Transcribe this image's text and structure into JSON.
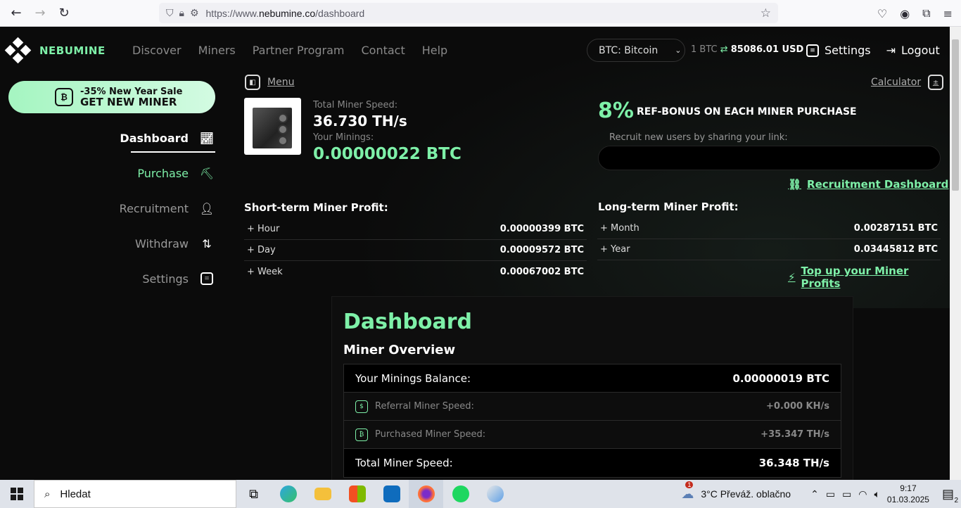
{
  "browser": {
    "url_prefix": "https://www.",
    "url_host": "nebumine.co",
    "url_path": "/dashboard"
  },
  "header": {
    "logo": "NEBUMINE",
    "nav": [
      "Discover",
      "Miners",
      "Partner Program",
      "Contact",
      "Help"
    ],
    "coin_select": "BTC: Bitcoin",
    "rate_prefix": "1 BTC",
    "rate_value": "85086.01 USD",
    "settings": "Settings",
    "logout": "Logout"
  },
  "sale": {
    "line1": "-35% New Year Sale",
    "line2": "GET NEW MINER"
  },
  "sidebar": {
    "items": [
      {
        "label": "Dashboard",
        "icon": "chart-icon"
      },
      {
        "label": "Purchase",
        "icon": "pickaxe-icon"
      },
      {
        "label": "Recruitment",
        "icon": "add-user-icon"
      },
      {
        "label": "Withdraw",
        "icon": "exchange-icon"
      },
      {
        "label": "Settings",
        "icon": "settings-icon"
      }
    ]
  },
  "main": {
    "menu": "Menu",
    "calculator": "Calculator",
    "total_speed_label": "Total Miner Speed:",
    "total_speed": "36.730 TH/s",
    "minings_label": "Your Minings:",
    "minings": "0.00000022 BTC",
    "ref_pct": "8%",
    "ref_text": "REF-BONUS ON EACH MINER PURCHASE",
    "ref_label": "Recruit new users by sharing your link:",
    "recruit_link": "Recruitment Dashboard",
    "short_title": "Short-term Miner Profit:",
    "short_rows": [
      {
        "label": "+ Hour",
        "value": "0.00000399 BTC"
      },
      {
        "label": "+ Day",
        "value": "0.00009572 BTC"
      },
      {
        "label": "+ Week",
        "value": "0.00067002 BTC"
      }
    ],
    "long_title": "Long-term Miner Profit:",
    "long_rows": [
      {
        "label": "+ Month",
        "value": "0.00287151 BTC"
      },
      {
        "label": "+ Year",
        "value": "0.03445812 BTC"
      }
    ],
    "topup": "Top up your Miner Profits"
  },
  "dashboard": {
    "title": "Dashboard",
    "overview": "Miner Overview",
    "rows": [
      {
        "label": "Your Minings Balance:",
        "value": "0.00000019 BTC"
      },
      {
        "label": "Referral Miner Speed:",
        "value": "+0.000 KH/s"
      },
      {
        "label": "Purchased Miner Speed:",
        "value": "+35.347 TH/s"
      },
      {
        "label": "Total Miner Speed:",
        "value": "36.348 TH/s"
      }
    ]
  },
  "taskbar": {
    "search": "Hledat",
    "weather": "3°C  Převáž. oblačno",
    "time": "9:17",
    "date": "01.03.2025",
    "notif": "2",
    "weather_badge": "1"
  },
  "colors": {
    "accent": "#7ef0a8",
    "bg": "#0b0b0b"
  }
}
